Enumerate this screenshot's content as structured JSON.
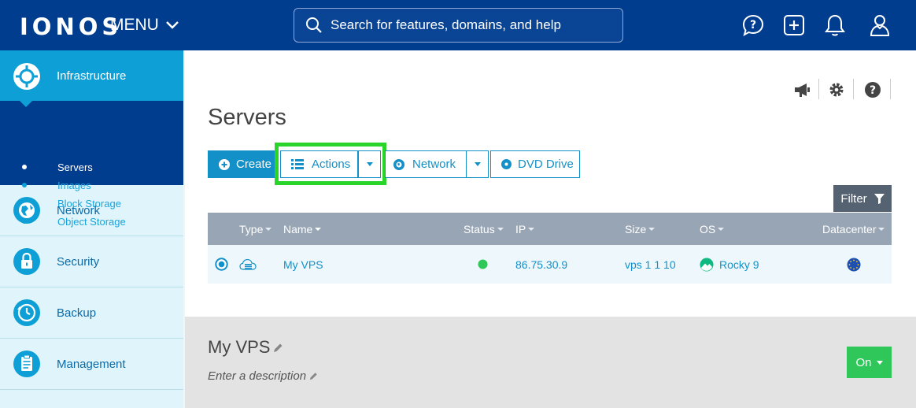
{
  "header": {
    "logo": "IONOS",
    "menu_label": "MENU",
    "search_placeholder": "Search for features, domains, and help"
  },
  "sidebar": {
    "items": [
      {
        "label": "Infrastructure"
      },
      {
        "label": "Network"
      },
      {
        "label": "Security"
      },
      {
        "label": "Backup"
      },
      {
        "label": "Management"
      }
    ],
    "sub_items": [
      {
        "label": "Servers"
      },
      {
        "label": "Images"
      },
      {
        "label": "Block Storage"
      },
      {
        "label": "Object Storage"
      }
    ]
  },
  "main": {
    "title": "Servers",
    "toolbar": {
      "create": "Create",
      "actions": "Actions",
      "network": "Network",
      "dvd": "DVD Drive"
    },
    "filter": "Filter",
    "table": {
      "columns": [
        "Type",
        "Name",
        "Status",
        "IP",
        "Size",
        "OS",
        "Datacenter"
      ],
      "rows": [
        {
          "name": "My VPS",
          "ip": "86.75.30.9",
          "size": "vps 1 1 10",
          "os": "Rocky 9"
        }
      ]
    }
  },
  "detail": {
    "title": "My VPS",
    "description": "Enter a description",
    "power": "On"
  },
  "colors": {
    "header_bg": "#003d8f",
    "accent": "#1390c7",
    "highlight": "#2ad42a",
    "status_on": "#2fc65a"
  }
}
